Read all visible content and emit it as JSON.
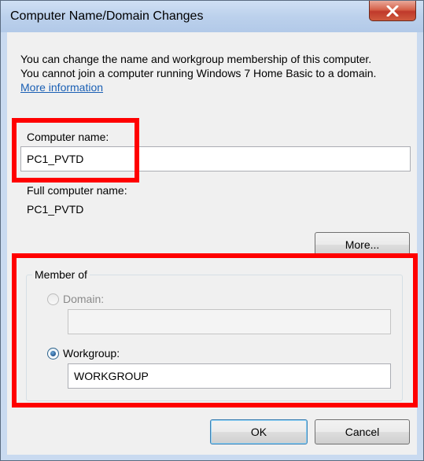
{
  "window": {
    "title": "Computer Name/Domain Changes"
  },
  "description": {
    "text": "You can change the name and workgroup membership of this computer. You cannot join a computer running Windows 7 Home Basic to a domain.",
    "link": "More information"
  },
  "computer_name": {
    "label": "Computer name:",
    "value": "PC1_PVTD"
  },
  "full_name": {
    "label": "Full computer name:",
    "value": "PC1_PVTD"
  },
  "more_button": "More...",
  "member_of": {
    "title": "Member of",
    "domain_label": "Domain:",
    "domain_value": "",
    "domain_selected": false,
    "workgroup_label": "Workgroup:",
    "workgroup_value": "WORKGROUP",
    "workgroup_selected": true
  },
  "buttons": {
    "ok": "OK",
    "cancel": "Cancel"
  },
  "colors": {
    "highlight": "#ff0000",
    "link": "#1a5fb4",
    "close_button": "#c0392b"
  },
  "icons": {
    "close": "close-icon"
  }
}
